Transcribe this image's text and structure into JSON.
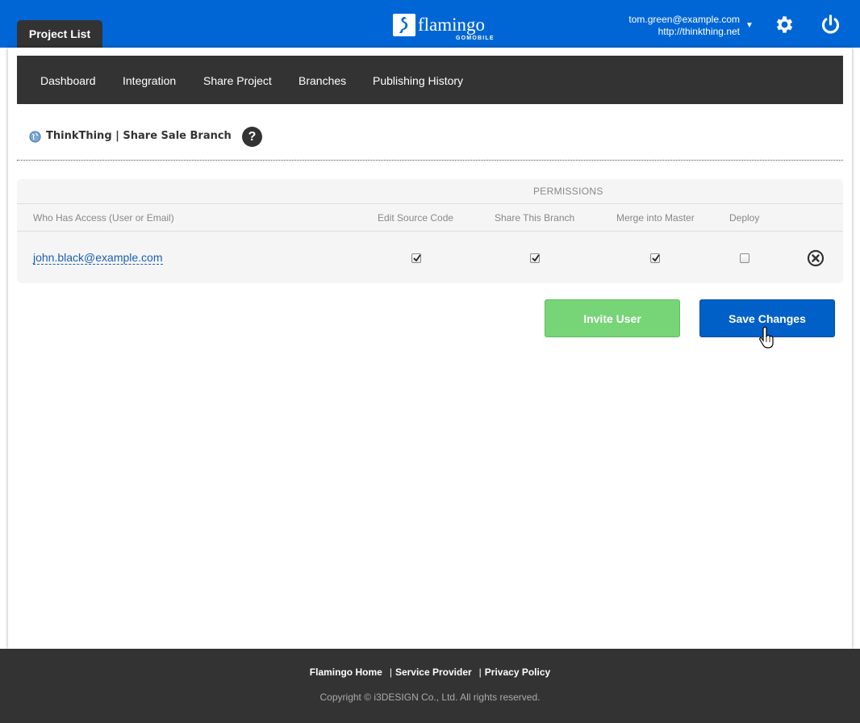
{
  "header": {
    "project_tab": "Project List",
    "logo_word": "flamingo",
    "logo_sub": "GOMOBILE",
    "account_email": "tom.green@example.com",
    "account_url": "http://thinkthing.net",
    "brand_color": "#0066d6"
  },
  "nav": {
    "items": [
      {
        "label": "Dashboard"
      },
      {
        "label": "Integration"
      },
      {
        "label": "Share Project"
      },
      {
        "label": "Branches"
      },
      {
        "label": "Publishing History"
      }
    ]
  },
  "page": {
    "title": "ThinkThing | Share Sale Branch",
    "help_glyph": "?"
  },
  "permissions": {
    "group_title": "PERMISSIONS",
    "columns": [
      "Who Has Access (User or Email)",
      "Edit Source Code",
      "Share This Branch",
      "Merge into Master",
      "Deploy"
    ],
    "rows": [
      {
        "user": "john.black@example.com",
        "edit_source_code": true,
        "share_this_branch": true,
        "merge_into_master": true,
        "deploy": false
      }
    ]
  },
  "actions": {
    "invite_label": "Invite User",
    "save_label": "Save Changes"
  },
  "footer": {
    "links": [
      "Flamingo Home",
      "Service Provider",
      "Privacy Policy"
    ],
    "copyright": "Copyright © i3DESIGN Co., Ltd. All rights reserved."
  }
}
